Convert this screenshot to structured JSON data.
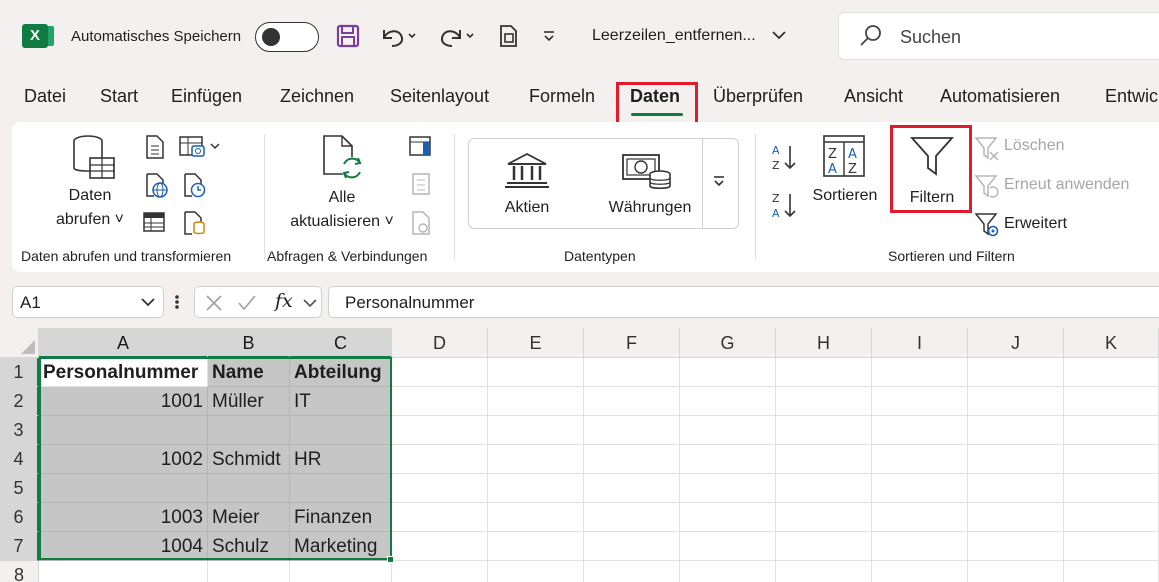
{
  "titlebar": {
    "autosave_label": "Automatisches Speichern",
    "filename": "Leerzeilen_entfernen...",
    "search_placeholder": "Suchen"
  },
  "tabs": [
    {
      "label": "Datei"
    },
    {
      "label": "Start"
    },
    {
      "label": "Einfügen"
    },
    {
      "label": "Zeichnen"
    },
    {
      "label": "Seitenlayout"
    },
    {
      "label": "Formeln"
    },
    {
      "label": "Daten"
    },
    {
      "label": "Überprüfen"
    },
    {
      "label": "Ansicht"
    },
    {
      "label": "Automatisieren"
    },
    {
      "label": "Entwic"
    }
  ],
  "ribbon": {
    "daten_abrufen_line1": "Daten",
    "daten_abrufen_line2": "abrufen",
    "alle_line1": "Alle",
    "alle_line2": "aktualisieren",
    "aktien": "Aktien",
    "waehrungen": "Währungen",
    "sortieren": "Sortieren",
    "filtern": "Filtern",
    "loeschen": "Löschen",
    "erneut": "Erneut anwenden",
    "erweitert": "Erweitert",
    "groups": {
      "g1": "Daten abrufen und transformieren",
      "g2": "Abfragen & Verbindungen",
      "g3": "Datentypen",
      "g4": "Sortieren und Filtern"
    }
  },
  "formula_bar": {
    "namebox": "A1",
    "fx": "fx",
    "content": "Personalnummer"
  },
  "sheet": {
    "columns": [
      "A",
      "B",
      "C",
      "D",
      "E",
      "F",
      "G",
      "H",
      "I",
      "J",
      "K"
    ],
    "rows": [
      "1",
      "2",
      "3",
      "4",
      "5",
      "6",
      "7",
      "8"
    ],
    "data": [
      [
        "Personalnummer",
        "Name",
        "Abteilung"
      ],
      [
        "1001",
        "Müller",
        "IT"
      ],
      [
        "",
        "",
        ""
      ],
      [
        "1002",
        "Schmidt",
        "HR"
      ],
      [
        "",
        "",
        ""
      ],
      [
        "1003",
        "Meier",
        "Finanzen"
      ],
      [
        "1004",
        "Schulz",
        "Marketing"
      ]
    ]
  },
  "colors": {
    "excel_green": "#107c41",
    "highlight_red": "#e01b2a",
    "selection_gray": "#c6c6c6"
  }
}
